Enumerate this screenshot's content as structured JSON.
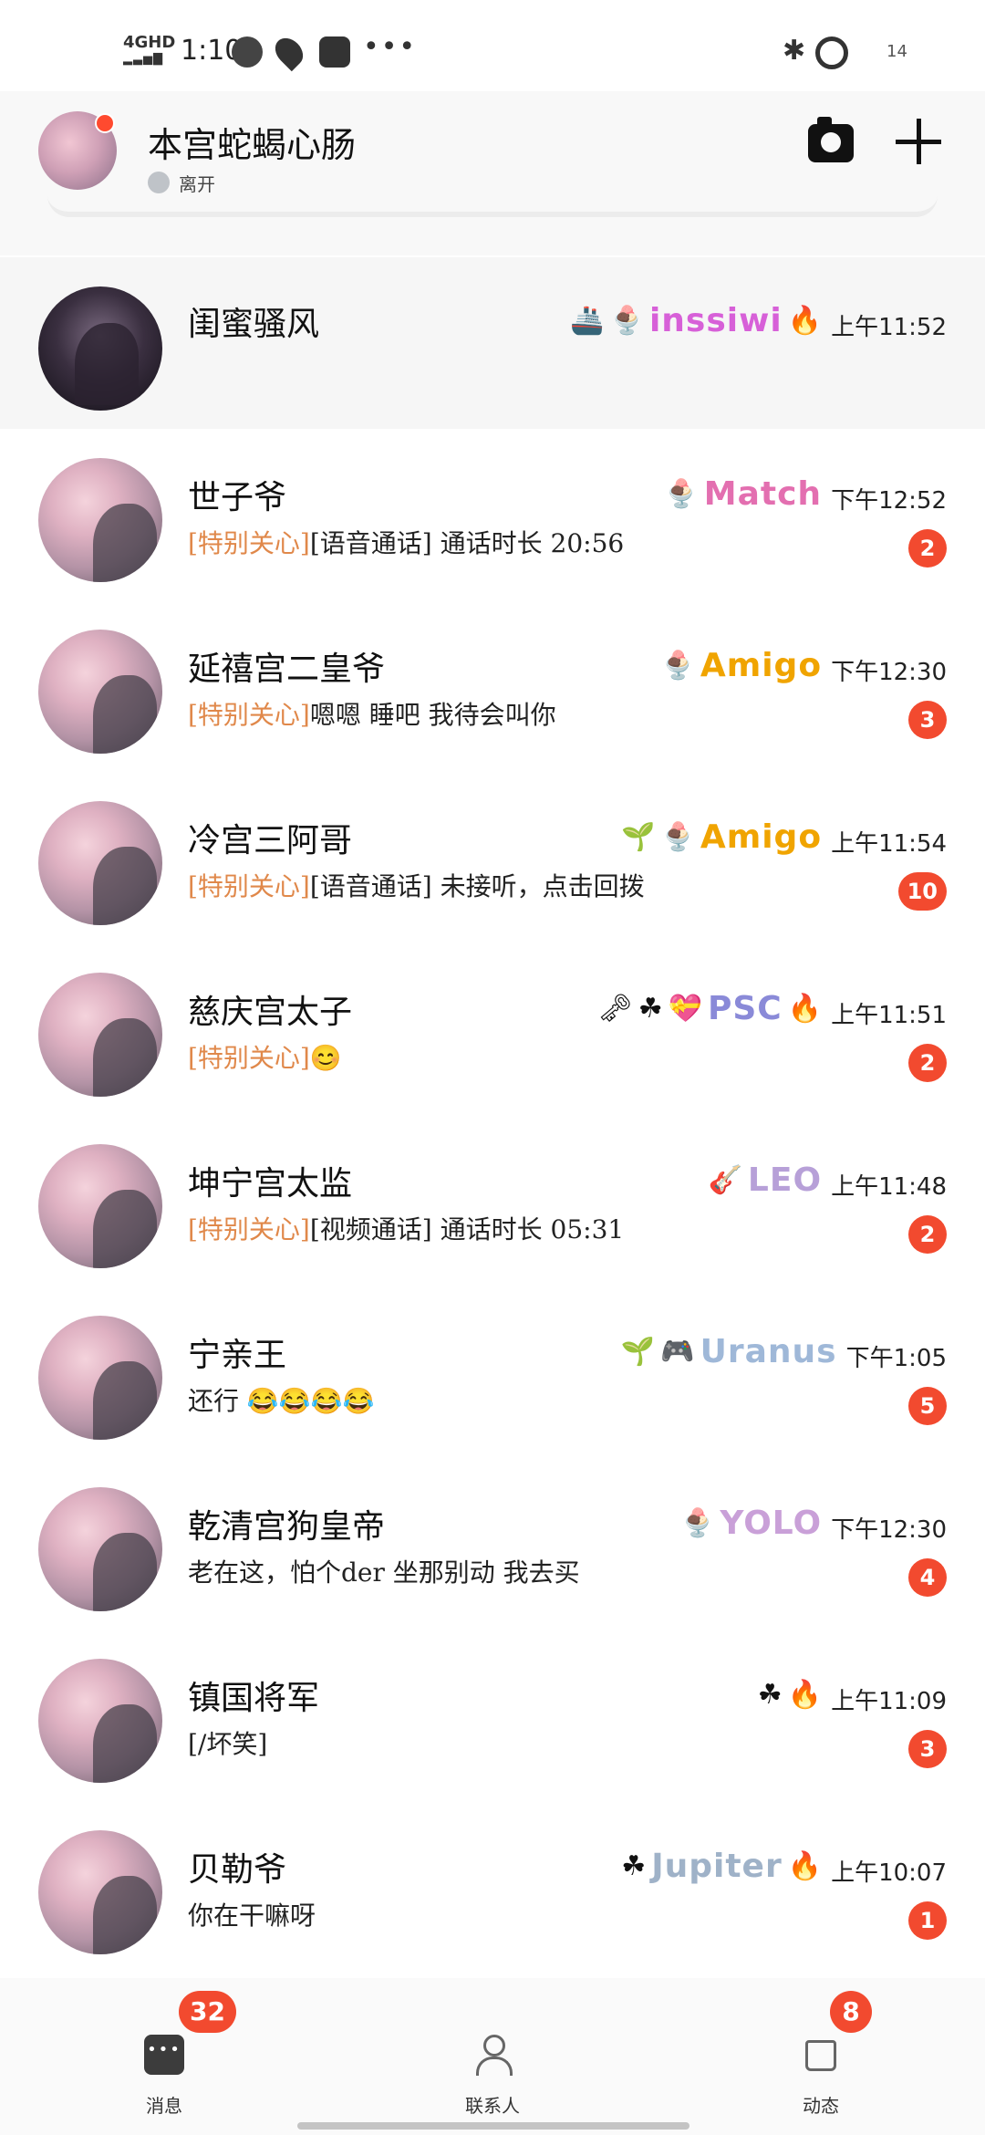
{
  "status_bar": {
    "network": "4GHD",
    "time": "1:10",
    "icons": [
      "wechat-icon",
      "location-icon",
      "app-icon",
      "more-dots"
    ],
    "more": "•••",
    "bluetooth": "✱",
    "battery": "14"
  },
  "header": {
    "name": "本宫蛇蝎心肠",
    "status": "离开",
    "camera": "camera-icon",
    "add": "plus-icon"
  },
  "chats": [
    {
      "name": "闺蜜骚风",
      "message": "",
      "tag": "",
      "badges": [
        "🚢",
        "🍨",
        "inssiwi",
        "🔥"
      ],
      "badge_colors": [
        "",
        "",
        "#d760d8",
        ""
      ],
      "time": "上午11:52",
      "unread": "",
      "pinned": true,
      "avatar": "dark"
    },
    {
      "name": "世子爷",
      "tag": "[特别关心]",
      "message": "[语音通话] 通话时长 20:56",
      "badges": [
        "🍨",
        "Match"
      ],
      "badge_colors": [
        "",
        "#e36fb0"
      ],
      "time": "下午12:52",
      "unread": "2"
    },
    {
      "name": "延禧宫二皇爷",
      "tag": "[特别关心]",
      "message": "嗯嗯 睡吧 我待会叫你",
      "badges": [
        "🍨",
        "Amigo"
      ],
      "badge_colors": [
        "",
        "#f0a400"
      ],
      "time": "下午12:30",
      "unread": "3"
    },
    {
      "name": "冷宫三阿哥",
      "tag": "[特别关心]",
      "message": "[语音通话] 未接听，点击回拨",
      "badges": [
        "🌱",
        "🍨",
        "Amigo"
      ],
      "badge_colors": [
        "",
        "",
        "#f0a400"
      ],
      "time": "上午11:54",
      "unread": "10"
    },
    {
      "name": "慈庆宫太子",
      "tag": "[特别关心]",
      "message": "😊",
      "badges": [
        "🗝",
        "☘",
        "💝",
        "PSC",
        "🔥"
      ],
      "badge_colors": [
        "",
        "",
        "",
        "#8a8ad8",
        ""
      ],
      "time": "上午11:51",
      "unread": "2"
    },
    {
      "name": "坤宁宫太监",
      "tag": "[特别关心]",
      "message": "[视频通话] 通话时长 05:31",
      "badges": [
        "🎸",
        "LEO"
      ],
      "badge_colors": [
        "",
        "#b7a0d8"
      ],
      "time": "上午11:48",
      "unread": "2"
    },
    {
      "name": "宁亲王",
      "tag": "",
      "message": "还行 😂😂😂😂",
      "badges": [
        "🌱",
        "🎮",
        "Uranus"
      ],
      "badge_colors": [
        "",
        "",
        "#9fb8d8"
      ],
      "time": "下午1:05",
      "unread": "5"
    },
    {
      "name": "乾清宫狗皇帝",
      "tag": "",
      "message": "老在这，怕个der 坐那别动 我去买",
      "badges": [
        "🍨",
        "YOLO"
      ],
      "badge_colors": [
        "",
        "#c9a0d8"
      ],
      "time": "下午12:30",
      "unread": "4"
    },
    {
      "name": "镇国将军",
      "tag": "",
      "message": "[/坏笑]",
      "badges": [
        "☘",
        "🔥"
      ],
      "badge_colors": [
        "",
        ""
      ],
      "time": "上午11:09",
      "unread": "3"
    },
    {
      "name": "贝勒爷",
      "tag": "",
      "message": "你在干嘛呀",
      "badges": [
        "☘",
        "Jupiter",
        "🔥"
      ],
      "badge_colors": [
        "",
        "#9fb2c8",
        ""
      ],
      "time": "上午10:07",
      "unread": "1"
    }
  ],
  "tabs": [
    {
      "label": "消息",
      "badge": "32",
      "icon": "message-icon"
    },
    {
      "label": "联系人",
      "badge": "",
      "icon": "person-icon"
    },
    {
      "label": "动态",
      "badge": "8",
      "icon": "shirt-icon"
    }
  ]
}
